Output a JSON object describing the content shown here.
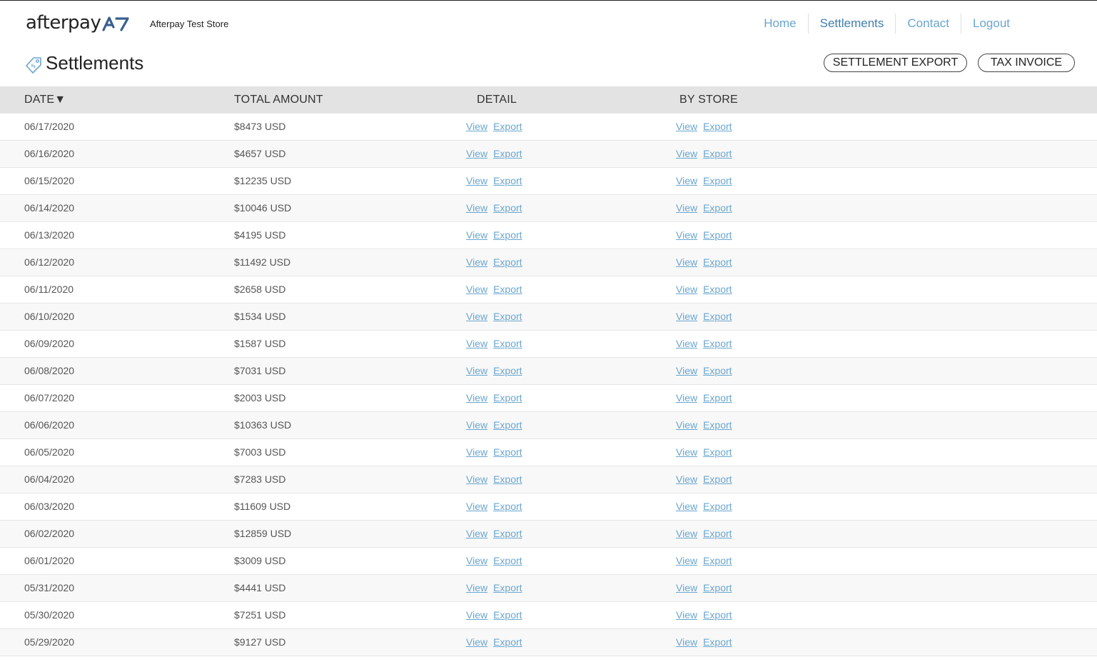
{
  "brand": {
    "logo_text": "afterpay",
    "store_name": "Afterpay Test Store",
    "logo_color": "#3a5f8f"
  },
  "nav": {
    "items": [
      "Home",
      "Settlements",
      "Contact",
      "Logout"
    ],
    "active": "Settlements",
    "link_color": "#6aa6cf"
  },
  "page": {
    "title": "Settlements",
    "icon": "price-tag-icon",
    "buttons": {
      "settlement_export": "SETTLEMENT EXPORT",
      "tax_invoice": "TAX INVOICE"
    }
  },
  "table": {
    "columns": {
      "date": "DATE▼",
      "total": "TOTAL AMOUNT",
      "detail": "DETAIL",
      "by_store": "BY STORE"
    },
    "link_view": "View",
    "link_export": "Export",
    "rows": [
      {
        "date": "06/17/2020",
        "total": "$8473 USD"
      },
      {
        "date": "06/16/2020",
        "total": "$4657 USD"
      },
      {
        "date": "06/15/2020",
        "total": "$12235 USD"
      },
      {
        "date": "06/14/2020",
        "total": "$10046 USD"
      },
      {
        "date": "06/13/2020",
        "total": "$4195 USD"
      },
      {
        "date": "06/12/2020",
        "total": "$11492 USD"
      },
      {
        "date": "06/11/2020",
        "total": "$2658 USD"
      },
      {
        "date": "06/10/2020",
        "total": "$1534 USD"
      },
      {
        "date": "06/09/2020",
        "total": "$1587 USD"
      },
      {
        "date": "06/08/2020",
        "total": "$7031 USD"
      },
      {
        "date": "06/07/2020",
        "total": "$2003 USD"
      },
      {
        "date": "06/06/2020",
        "total": "$10363 USD"
      },
      {
        "date": "06/05/2020",
        "total": "$7003 USD"
      },
      {
        "date": "06/04/2020",
        "total": "$7283 USD"
      },
      {
        "date": "06/03/2020",
        "total": "$11609 USD"
      },
      {
        "date": "06/02/2020",
        "total": "$12859 USD"
      },
      {
        "date": "06/01/2020",
        "total": "$3009 USD"
      },
      {
        "date": "05/31/2020",
        "total": "$4441 USD"
      },
      {
        "date": "05/30/2020",
        "total": "$7251 USD"
      },
      {
        "date": "05/29/2020",
        "total": "$9127 USD"
      }
    ]
  }
}
